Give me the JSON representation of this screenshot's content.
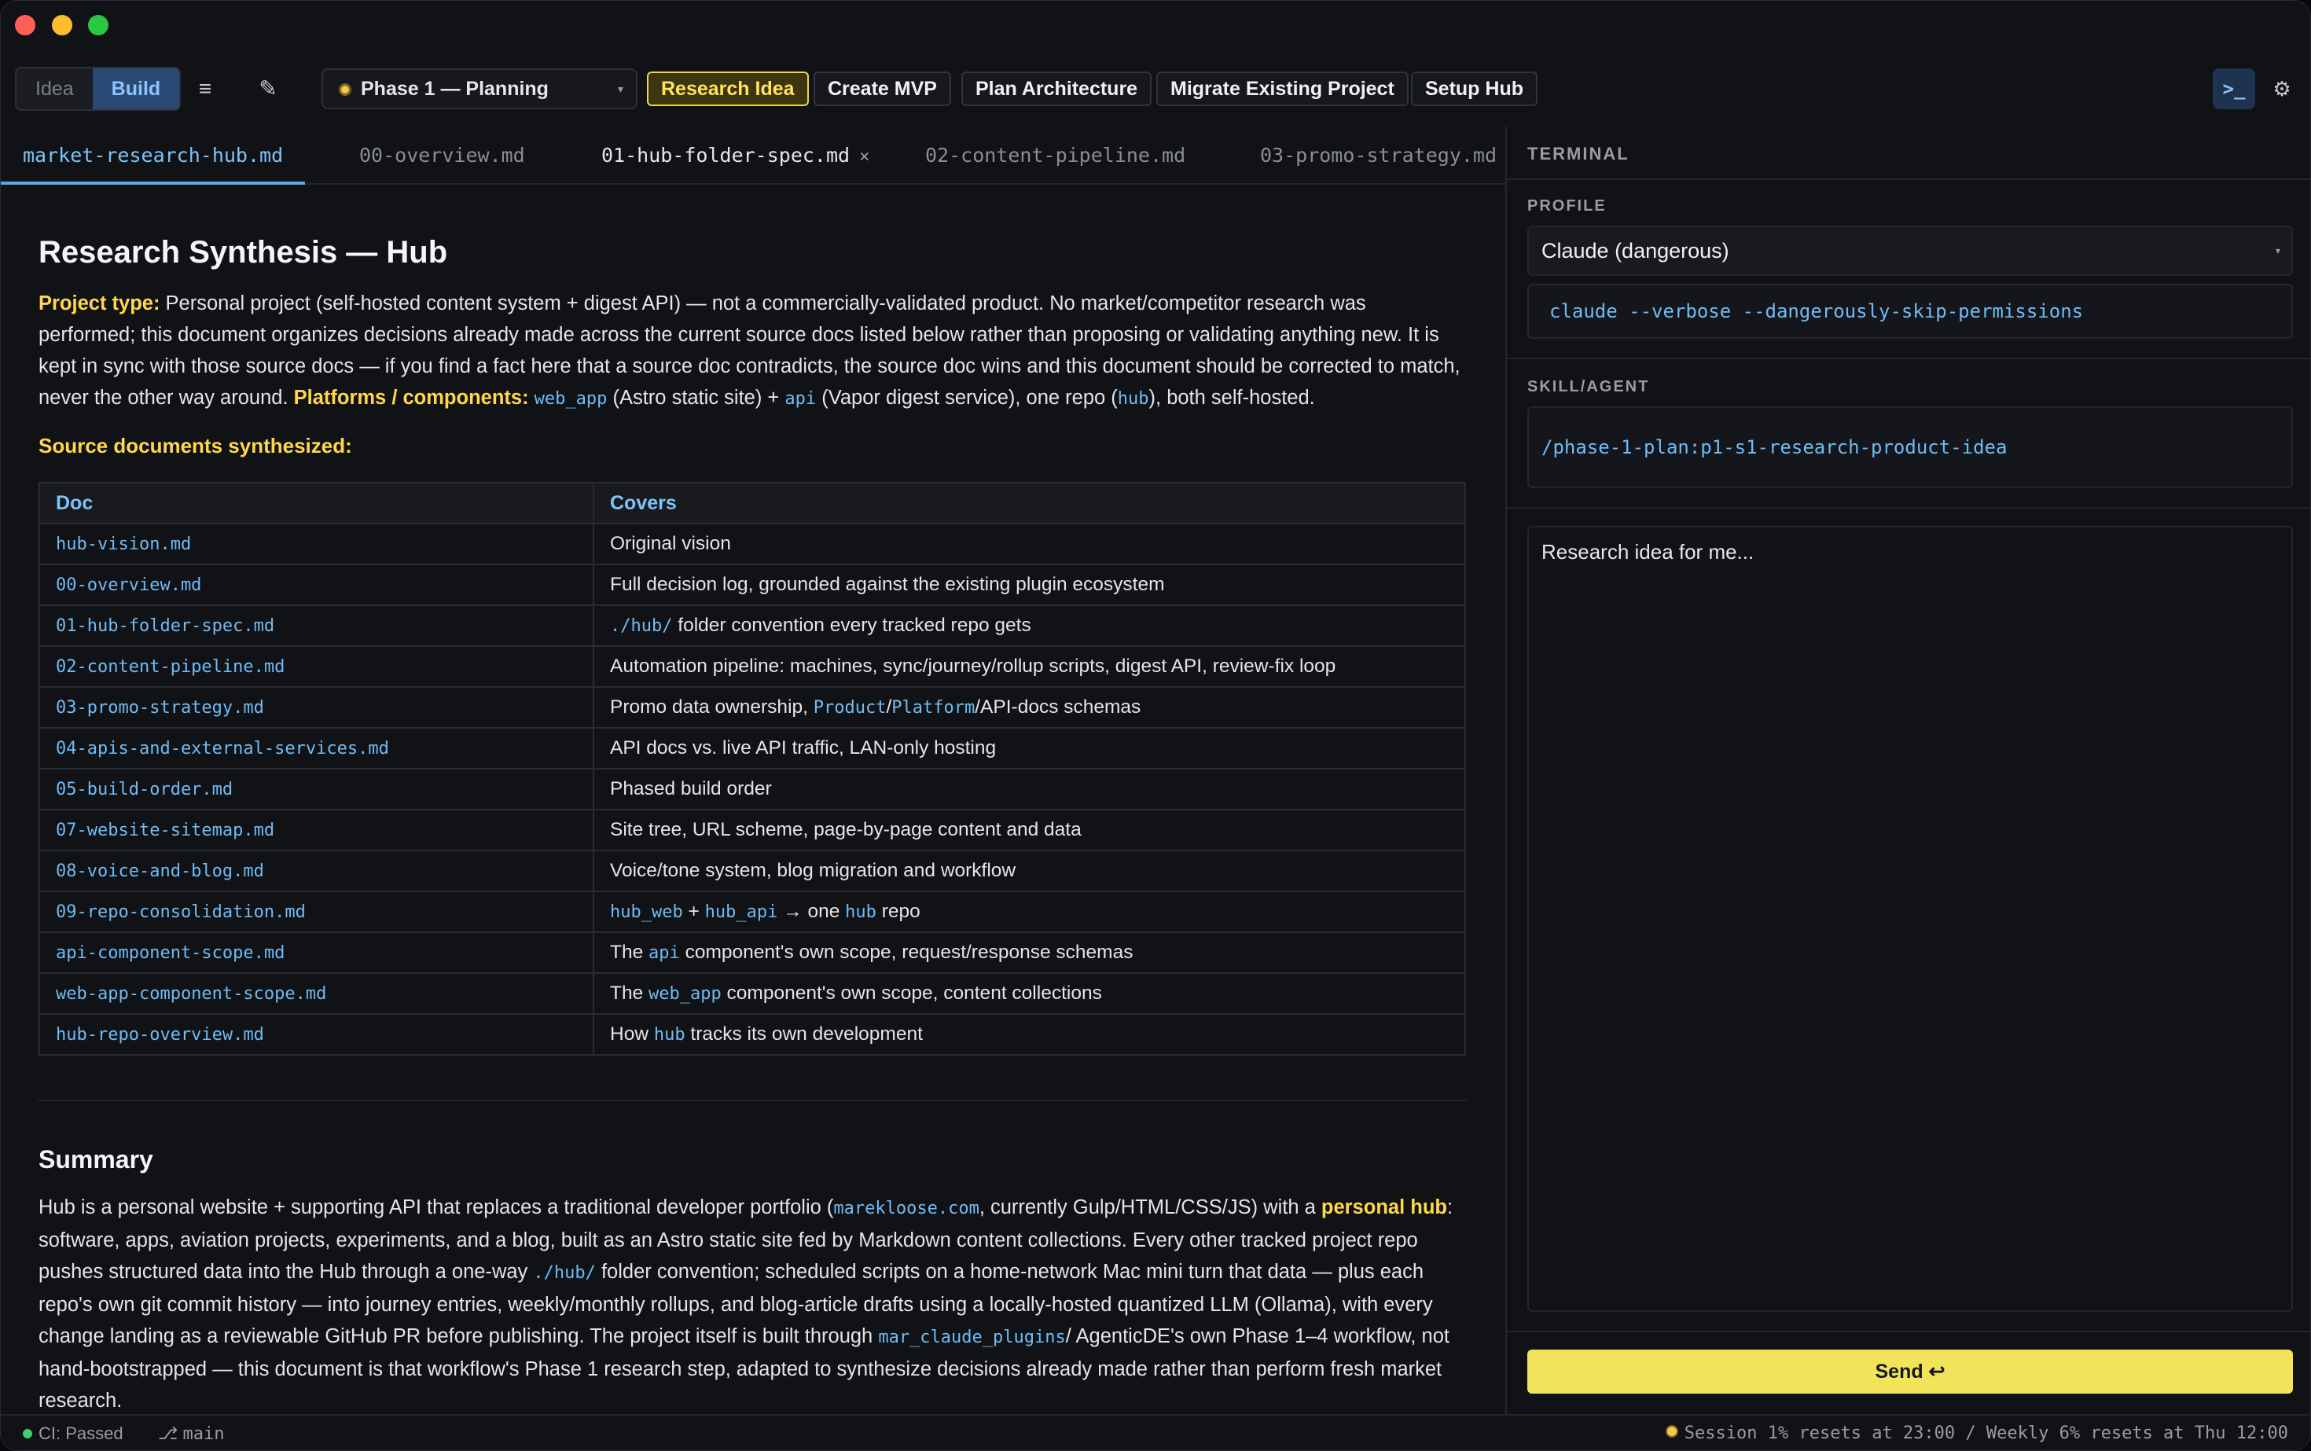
{
  "toolbar": {
    "mode_tabs": [
      "Idea",
      "Build"
    ],
    "list_icon": "≡",
    "edit_icon": "✎",
    "phase": "Phase 1 — Planning",
    "workflow_buttons": [
      "Research Idea",
      "Create MVP",
      "Plan Architecture",
      "Migrate Existing Project",
      "Setup Hub"
    ],
    "terminal_toggle": ">_",
    "settings_icon": "⚙"
  },
  "tabs": [
    {
      "label": "market-research-hub.md"
    },
    {
      "label": "00-overview.md"
    },
    {
      "label": "01-hub-folder-spec.md",
      "close": "×"
    },
    {
      "label": "02-content-pipeline.md"
    },
    {
      "label": "03-promo-strategy.md"
    }
  ],
  "document": {
    "title": "Research Synthesis — Hub",
    "project_type_label": "Project type:",
    "project_type_text": " Personal project (self-hosted content system + digest API) — not a commercially-validated product. No market/competitor research was performed; this document organizes decisions already made across the current source docs listed below rather than proposing or validating anything new. It is kept in sync with those source docs — if you find a fact here that a source doc contradicts, the source doc wins and this document should be corrected to match, never the other way around. ",
    "platforms_label": "Platforms / components:",
    "platforms_code_1": "web_app",
    "platforms_text_1": " (Astro static site) + ",
    "platforms_code_2": "api",
    "platforms_text_2": " (Vapor digest service), one repo (",
    "platforms_code_3": "hub",
    "platforms_text_3": "), both self-hosted.",
    "sources_heading": "Source documents synthesized:",
    "table_headers": [
      "Doc",
      "Covers"
    ],
    "table_rows": [
      {
        "doc": "hub-vision.md",
        "covers": [
          {
            "t": "Original vision"
          }
        ]
      },
      {
        "doc": "00-overview.md",
        "covers": [
          {
            "t": "Full decision log, grounded against the existing plugin ecosystem"
          }
        ]
      },
      {
        "doc": "01-hub-folder-spec.md",
        "covers": [
          {
            "c": "./hub/"
          },
          {
            "t": " folder convention every tracked repo gets"
          }
        ]
      },
      {
        "doc": "02-content-pipeline.md",
        "covers": [
          {
            "t": "Automation pipeline: machines, sync/journey/rollup scripts, digest API, review-fix loop"
          }
        ]
      },
      {
        "doc": "03-promo-strategy.md",
        "covers": [
          {
            "t": "Promo data ownership, "
          },
          {
            "c": "Product"
          },
          {
            "t": "/"
          },
          {
            "c": "Platform"
          },
          {
            "t": "/API-docs schemas"
          }
        ]
      },
      {
        "doc": "04-apis-and-external-services.md",
        "covers": [
          {
            "t": "API docs vs. live API traffic, LAN-only hosting"
          }
        ]
      },
      {
        "doc": "05-build-order.md",
        "covers": [
          {
            "t": "Phased build order"
          }
        ]
      },
      {
        "doc": "07-website-sitemap.md",
        "covers": [
          {
            "t": "Site tree, URL scheme, page-by-page content and data"
          }
        ]
      },
      {
        "doc": "08-voice-and-blog.md",
        "covers": [
          {
            "t": "Voice/tone system, blog migration and workflow"
          }
        ]
      },
      {
        "doc": "09-repo-consolidation.md",
        "covers": [
          {
            "c": "hub_web"
          },
          {
            "t": " + "
          },
          {
            "c": "hub_api"
          },
          {
            "t": " → one "
          },
          {
            "c": "hub"
          },
          {
            "t": " repo"
          }
        ]
      },
      {
        "doc": "api-component-scope.md",
        "covers": [
          {
            "t": "The "
          },
          {
            "c": "api"
          },
          {
            "t": " component's own scope, request/response schemas"
          }
        ]
      },
      {
        "doc": "web-app-component-scope.md",
        "covers": [
          {
            "t": "The "
          },
          {
            "c": "web_app"
          },
          {
            "t": " component's own scope, content collections"
          }
        ]
      },
      {
        "doc": "hub-repo-overview.md",
        "covers": [
          {
            "t": "How "
          },
          {
            "c": "hub"
          },
          {
            "t": " tracks its own development"
          }
        ]
      }
    ],
    "summary_heading": "Summary",
    "summary_parts": [
      {
        "t": "Hub is a personal website + supporting API that replaces a traditional developer portfolio ("
      },
      {
        "c": "marekloose.com"
      },
      {
        "t": ", currently Gulp/HTML/CSS/JS) with a "
      },
      {
        "k": "personal hub"
      },
      {
        "t": ": software, apps, aviation projects, experiments, and a blog, built as an Astro static site fed by Markdown content collections. Every other tracked project repo pushes structured data into the Hub through a one-way "
      },
      {
        "c": "./hub/"
      },
      {
        "t": " folder convention; scheduled scripts on a home-network Mac mini turn that data — plus each repo's own git commit history — into journey entries, weekly/monthly rollups, and blog-article drafts using a locally-hosted quantized LLM (Ollama), with every change landing as a reviewable GitHub PR before publishing. The project itself is built through "
      },
      {
        "c": "mar_claude_plugins"
      },
      {
        "t": "/ AgenticDE's own Phase 1–4 workflow, not hand-bootstrapped — this document is that workflow's Phase 1 research step, adapted to synthesize decisions already made rather than perform fresh market research."
      }
    ]
  },
  "terminal": {
    "title": "TERMINAL",
    "profile_label": "PROFILE",
    "profile_value": "Claude (dangerous)",
    "command": "claude --verbose --dangerously-skip-permissions",
    "skill_label": "SKILL/AGENT",
    "skill_value": "/phase-1-plan:p1-s1-research-product-idea",
    "prompt_placeholder": "Research idea for me...",
    "send_label": "Send ↩"
  },
  "statusbar": {
    "ci": "CI: Passed",
    "branch_icon": "⎇",
    "branch": "main",
    "session": "Session 1% resets at 23:00 / Weekly 6% resets at Thu 12:00"
  },
  "colors": {
    "accent_blue": "#5aa9e6",
    "highlight_yellow": "#ffd84a",
    "send_yellow": "#f2e45a",
    "status_green": "#3ecf6e"
  }
}
